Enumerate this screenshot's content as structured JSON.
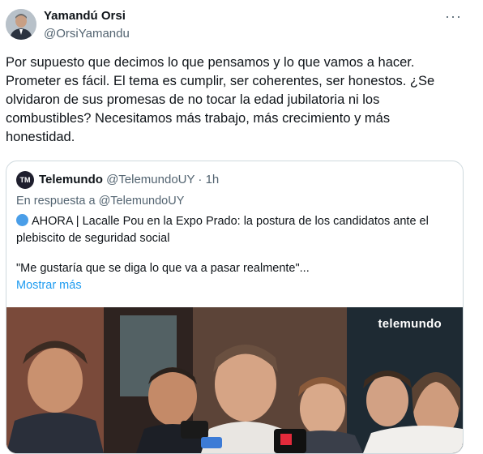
{
  "author": {
    "name": "Yamandú Orsi",
    "handle": "@OrsiYamandu"
  },
  "tweet": {
    "text": "Por supuesto que decimos lo que pensamos y lo que vamos a hacer. Prometer es fácil. El tema es cumplir, ser coherentes, ser honestos. ¿Se olvidaron de sus promesas de no tocar la edad jubilatoria ni los combustibles? Necesitamos más trabajo, más crecimiento y más honestidad."
  },
  "more_options": "···",
  "quoted": {
    "avatar_text": "TM",
    "name": "Telemundo",
    "handle": "@TelemundoUY",
    "time": "· 1h",
    "reply_to": "En respuesta a @TelemundoUY",
    "headline": "AHORA | Lacalle Pou en la Expo Prado: la postura de los candidatos ante el plebiscito de seguridad social",
    "quote_text": "\"Me gustaría que se diga lo que va a pasar realmente\"...",
    "show_more": "Mostrar más",
    "media_watermark": "telemundo"
  },
  "colors": {
    "text": "#0f1419",
    "muted": "#536471",
    "link": "#1d9bf0",
    "border": "#cfd9de"
  }
}
